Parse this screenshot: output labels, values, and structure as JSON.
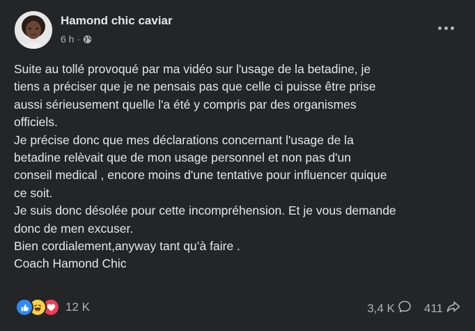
{
  "post": {
    "author": "Hamond chic caviar",
    "time": "6 h",
    "separator": "·",
    "body": "Suite au tollé provoqué par ma vidéo  sur l'usage de la betadine, je\ntiens a préciser que je ne pensais pas que celle ci  puisse être prise\naussi sérieusement quelle l'a  été y compris par des organismes\nofficiels.\nJe précise donc que mes déclarations concernant l'usage de la\nbetadine relèvait que de mon usage personnel et  non pas d'un\nconseil medical , encore moins d'une tentative pour  influencer quique\nce soit.\nJe suis donc désolée pour cette incompréhension.  Et je vous demande\ndonc de men excuser.\nBien cordialement,anyway tant qu’à faire .\nCoach Hamond Chic"
  },
  "footer": {
    "reaction_count": "12 K",
    "comments": "3,4 K",
    "shares": "411"
  },
  "icons": {
    "privacy": "globe-icon",
    "more": "more-options-icon",
    "reactions": [
      "like-icon",
      "haha-icon",
      "love-icon"
    ],
    "comment": "comment-icon",
    "share": "share-icon"
  },
  "colors": {
    "background": "#242526",
    "text_primary": "#e4e6eb",
    "text_secondary": "#b0b3b8",
    "like": "#2e89ff",
    "haha": "#f7d247",
    "love": "#f33e58"
  }
}
